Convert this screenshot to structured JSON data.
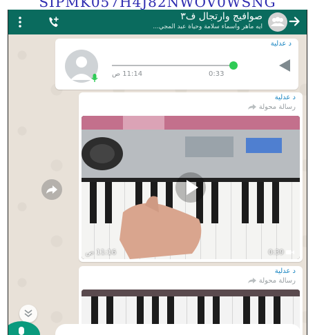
{
  "overlay": {
    "top_text": "SIPMK057H4J82NWOV0WSNG"
  },
  "header": {
    "title": "صوافيج وارتجال ف٣",
    "subtitle": "ايه ماهر واسماء سلامة وحياة عبد المجي..."
  },
  "messages": {
    "voice": {
      "sender": "د عدلية",
      "time": "11:14 ص",
      "duration": "0:33"
    },
    "video1": {
      "sender": "د عدلية",
      "forwarded": "رسالة محولة",
      "time": "11:16 ص",
      "duration": "0:39"
    },
    "video2": {
      "sender": "د عدلية",
      "forwarded": "رسالة محولة"
    }
  },
  "icons": {
    "back": "arrow-left-icon",
    "call": "add-call-icon",
    "menu": "more-vert-icon",
    "play": "play-icon",
    "mic": "mic-icon",
    "forward": "forward-icon",
    "video_camera": "videocam-icon",
    "scroll_down": "double-chevron-down-icon"
  },
  "colors": {
    "header": "#0a6b5e",
    "accent_green": "#2fcb55",
    "sender_name": "#1b86c2",
    "action_button": "#0a9a7d"
  }
}
